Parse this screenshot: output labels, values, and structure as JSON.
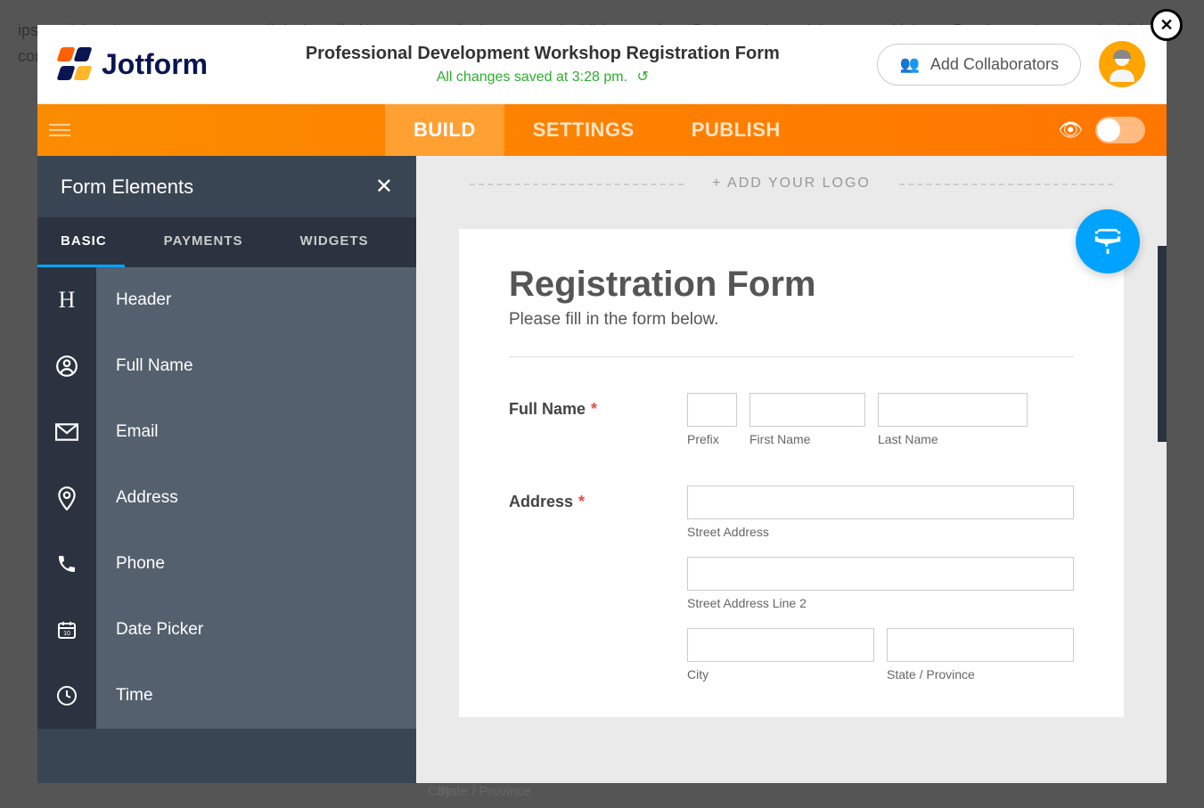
{
  "background_text": "ipsum dolor sit amet consectetur adipiscing elit. Nostrud exercitation tempor incididunt veniam. Duis aute irure dolor nostrud labore. Do eiusmod tempor incididunt commodo. Do eiusmod tempor aliqua use. Fugiat nulla pariatur culpa.",
  "header": {
    "logo_text": "Jotform",
    "form_title": "Professional Development Workshop Registration Form",
    "save_status": "All changes saved at 3:28 pm.",
    "collab_label": "Add Collaborators"
  },
  "tabbar": {
    "tabs": [
      "BUILD",
      "SETTINGS",
      "PUBLISH"
    ],
    "active": "BUILD"
  },
  "sidebar": {
    "title": "Form Elements",
    "tabs": [
      "BASIC",
      "PAYMENTS",
      "WIDGETS"
    ],
    "active_tab": "BASIC",
    "elements": [
      {
        "icon": "H",
        "label": "Header"
      },
      {
        "icon": "user",
        "label": "Full Name"
      },
      {
        "icon": "mail",
        "label": "Email"
      },
      {
        "icon": "pin",
        "label": "Address"
      },
      {
        "icon": "phone",
        "label": "Phone"
      },
      {
        "icon": "calendar",
        "label": "Date Picker"
      },
      {
        "icon": "clock",
        "label": "Time"
      }
    ]
  },
  "canvas": {
    "logo_placeholder": "+ ADD YOUR LOGO",
    "form_heading": "Registration Form",
    "form_sub": "Please fill in the form below.",
    "fields": {
      "full_name": {
        "label": "Full Name",
        "sublabels": {
          "prefix": "Prefix",
          "first": "First Name",
          "last": "Last Name"
        }
      },
      "address": {
        "label": "Address",
        "sublabels": {
          "street": "Street Address",
          "street2": "Street Address Line 2",
          "city": "City",
          "state": "State / Province"
        }
      }
    }
  },
  "footer": {
    "city": "City",
    "state": "State / Province"
  }
}
